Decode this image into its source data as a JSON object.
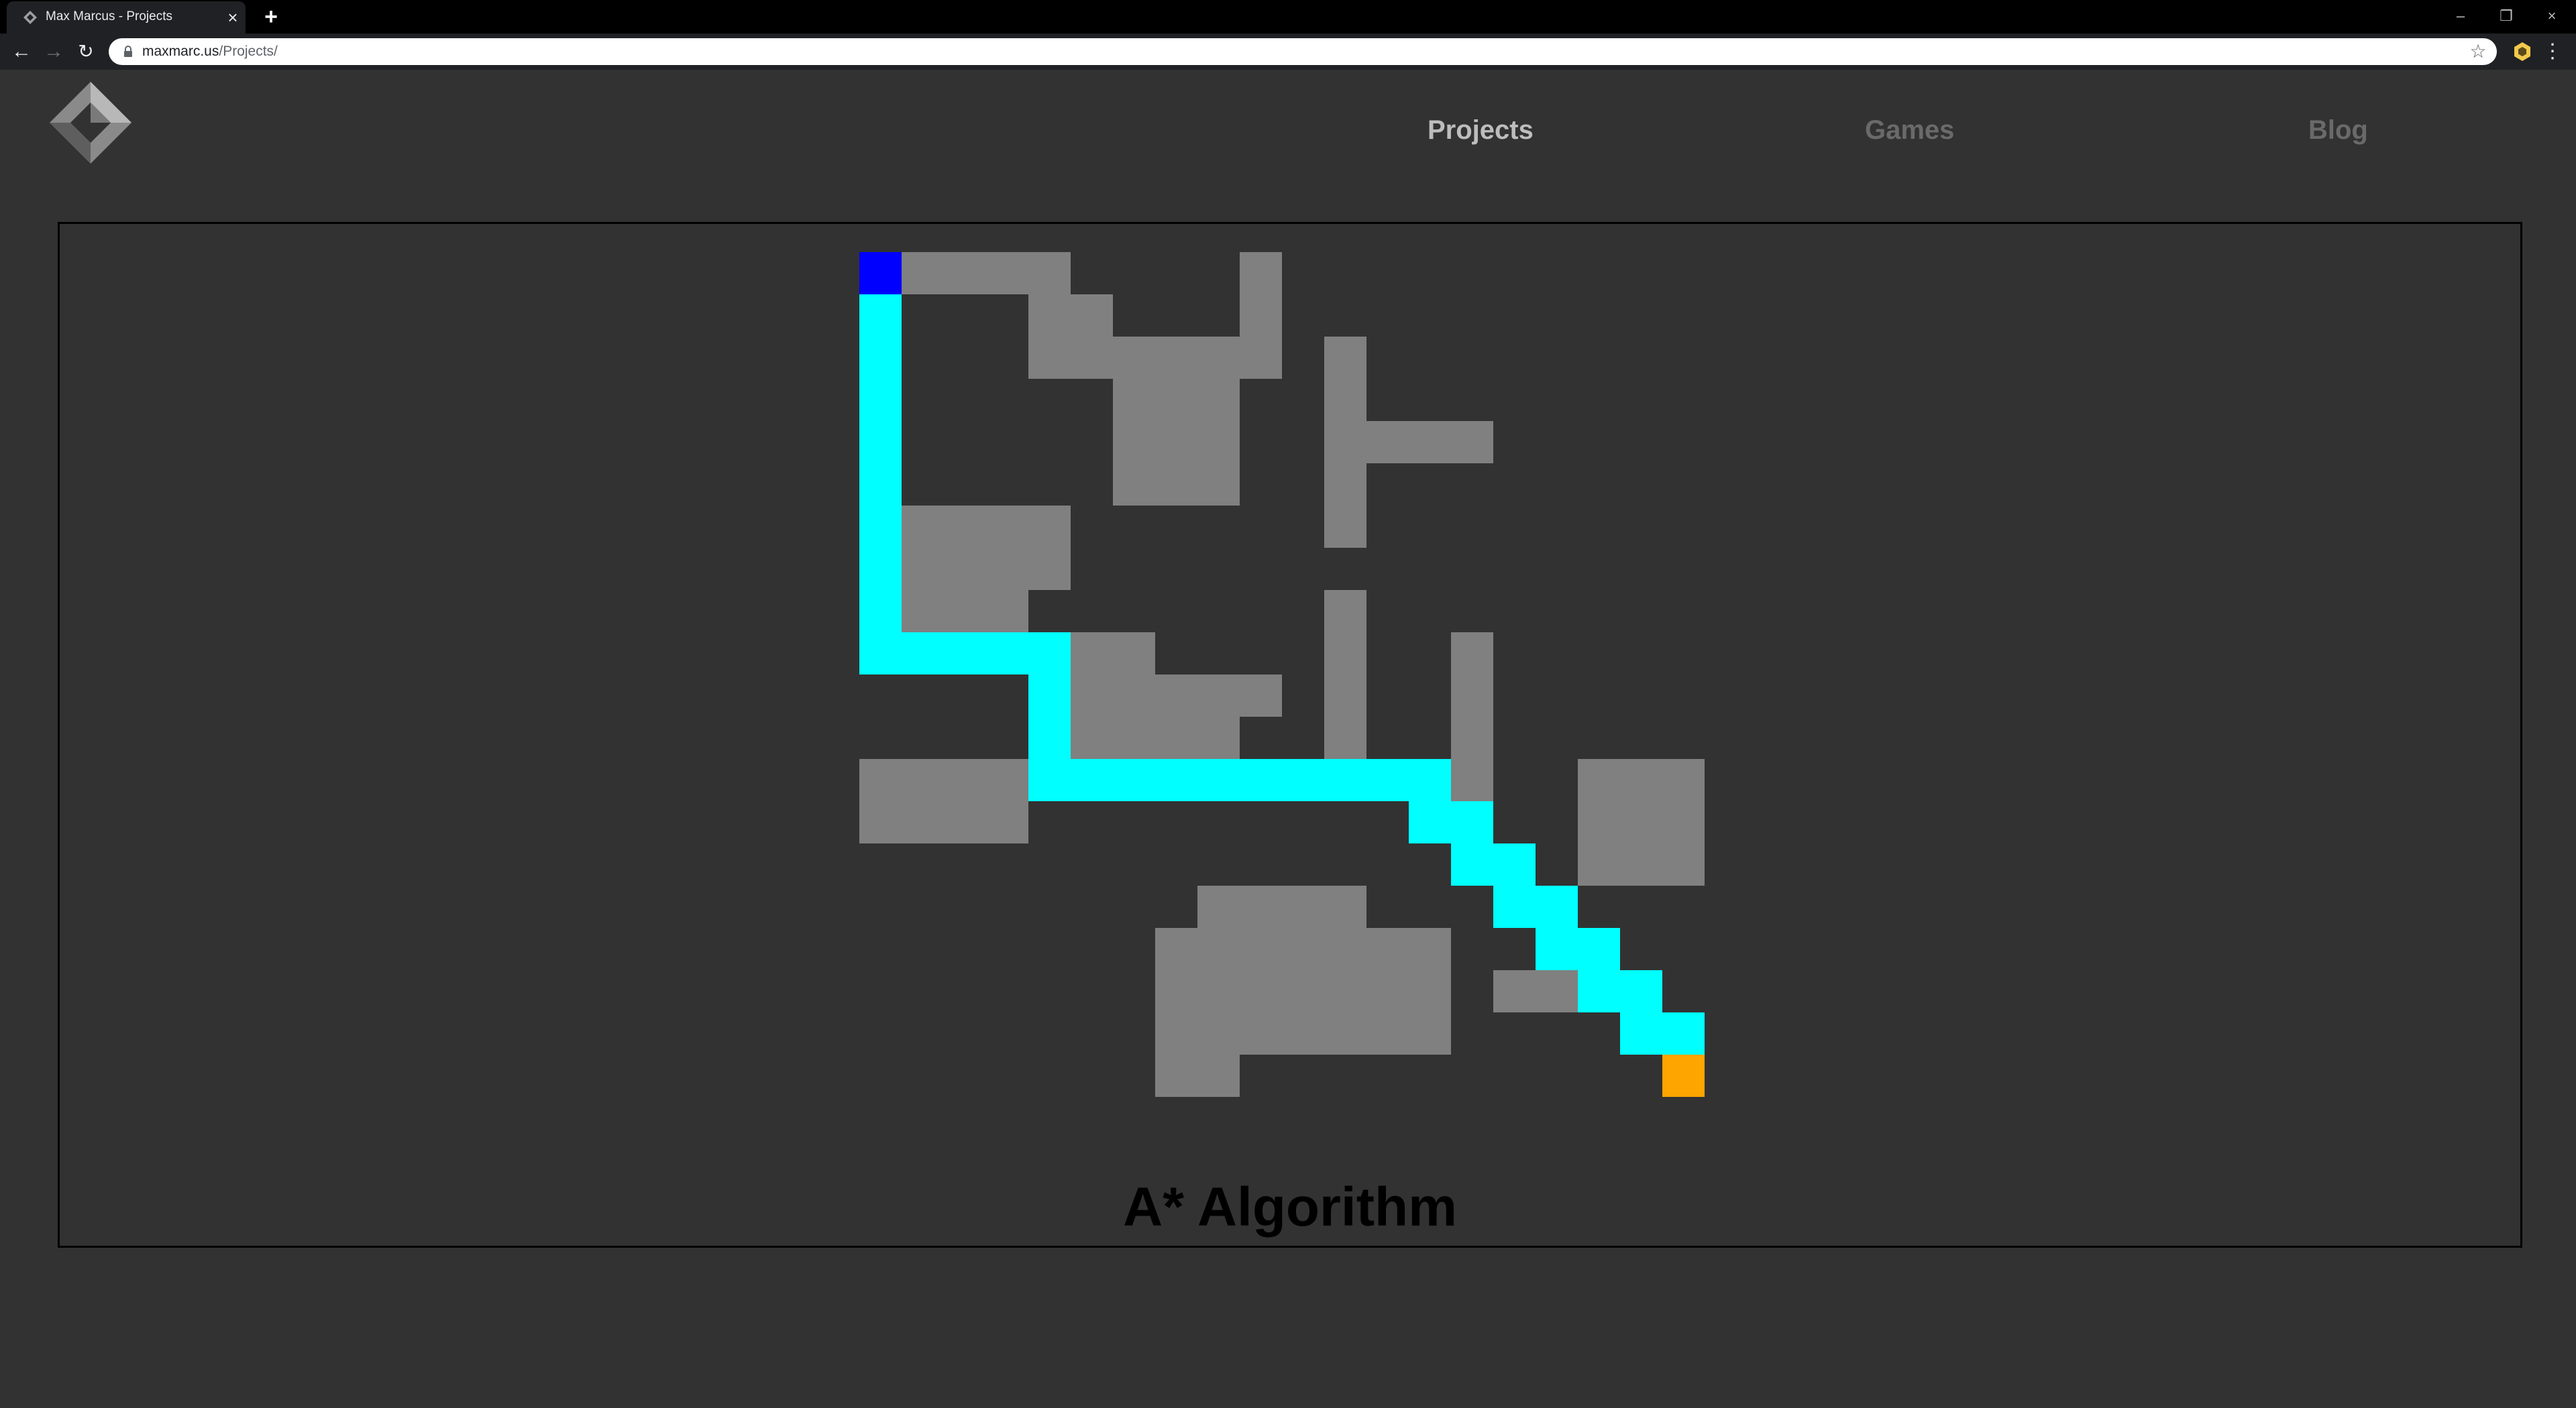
{
  "browser": {
    "tab_title": "Max Marcus - Projects",
    "url_host": "maxmarc.us",
    "url_path": "/Projects/"
  },
  "nav": {
    "links": [
      "Projects",
      "Games",
      "Blog"
    ],
    "active": "Projects"
  },
  "project": {
    "title": "A* Algorithm",
    "grid": {
      "rows": 20,
      "cols": 20,
      "colors": {
        "wall": "#808080",
        "path": "#00ffff",
        "start": "#0000ff",
        "goal": "#ffa500"
      },
      "start": [
        0,
        0
      ],
      "goal": [
        19,
        19
      ],
      "walls": [
        [
          0,
          1
        ],
        [
          0,
          2
        ],
        [
          0,
          3
        ],
        [
          0,
          4
        ],
        [
          0,
          9
        ],
        [
          1,
          4
        ],
        [
          1,
          5
        ],
        [
          1,
          9
        ],
        [
          2,
          4
        ],
        [
          2,
          5
        ],
        [
          2,
          6
        ],
        [
          2,
          7
        ],
        [
          2,
          8
        ],
        [
          2,
          9
        ],
        [
          2,
          11
        ],
        [
          3,
          6
        ],
        [
          3,
          7
        ],
        [
          3,
          8
        ],
        [
          3,
          11
        ],
        [
          4,
          6
        ],
        [
          4,
          7
        ],
        [
          4,
          8
        ],
        [
          4,
          11
        ],
        [
          4,
          12
        ],
        [
          4,
          13
        ],
        [
          4,
          14
        ],
        [
          5,
          6
        ],
        [
          5,
          7
        ],
        [
          5,
          8
        ],
        [
          5,
          11
        ],
        [
          6,
          1
        ],
        [
          6,
          2
        ],
        [
          6,
          3
        ],
        [
          6,
          4
        ],
        [
          6,
          11
        ],
        [
          7,
          1
        ],
        [
          7,
          2
        ],
        [
          7,
          3
        ],
        [
          7,
          4
        ],
        [
          8,
          1
        ],
        [
          8,
          2
        ],
        [
          8,
          3
        ],
        [
          8,
          11
        ],
        [
          9,
          5
        ],
        [
          9,
          6
        ],
        [
          9,
          11
        ],
        [
          9,
          14
        ],
        [
          10,
          5
        ],
        [
          10,
          6
        ],
        [
          10,
          7
        ],
        [
          10,
          8
        ],
        [
          10,
          9
        ],
        [
          10,
          11
        ],
        [
          10,
          14
        ],
        [
          11,
          5
        ],
        [
          11,
          6
        ],
        [
          11,
          7
        ],
        [
          11,
          8
        ],
        [
          11,
          11
        ],
        [
          11,
          14
        ],
        [
          12,
          0
        ],
        [
          12,
          1
        ],
        [
          12,
          2
        ],
        [
          12,
          3
        ],
        [
          12,
          14
        ],
        [
          12,
          17
        ],
        [
          12,
          18
        ],
        [
          12,
          19
        ],
        [
          13,
          0
        ],
        [
          13,
          1
        ],
        [
          13,
          2
        ],
        [
          13,
          3
        ],
        [
          13,
          17
        ],
        [
          13,
          18
        ],
        [
          13,
          19
        ],
        [
          14,
          17
        ],
        [
          14,
          18
        ],
        [
          14,
          19
        ],
        [
          15,
          8
        ],
        [
          15,
          9
        ],
        [
          15,
          10
        ],
        [
          15,
          11
        ],
        [
          16,
          7
        ],
        [
          16,
          8
        ],
        [
          16,
          9
        ],
        [
          16,
          10
        ],
        [
          16,
          11
        ],
        [
          16,
          12
        ],
        [
          16,
          13
        ],
        [
          17,
          7
        ],
        [
          17,
          8
        ],
        [
          17,
          9
        ],
        [
          17,
          10
        ],
        [
          17,
          11
        ],
        [
          17,
          12
        ],
        [
          17,
          13
        ],
        [
          17,
          15
        ],
        [
          17,
          16
        ],
        [
          18,
          7
        ],
        [
          18,
          8
        ],
        [
          18,
          9
        ],
        [
          18,
          10
        ],
        [
          18,
          11
        ],
        [
          18,
          12
        ],
        [
          18,
          13
        ],
        [
          19,
          7
        ],
        [
          19,
          8
        ]
      ],
      "path": [
        [
          1,
          0
        ],
        [
          2,
          0
        ],
        [
          3,
          0
        ],
        [
          4,
          0
        ],
        [
          5,
          0
        ],
        [
          6,
          0
        ],
        [
          7,
          0
        ],
        [
          8,
          0
        ],
        [
          9,
          0
        ],
        [
          9,
          1
        ],
        [
          9,
          2
        ],
        [
          9,
          3
        ],
        [
          9,
          4
        ],
        [
          10,
          4
        ],
        [
          11,
          4
        ],
        [
          12,
          4
        ],
        [
          12,
          5
        ],
        [
          12,
          6
        ],
        [
          12,
          7
        ],
        [
          12,
          8
        ],
        [
          12,
          9
        ],
        [
          12,
          10
        ],
        [
          12,
          11
        ],
        [
          12,
          12
        ],
        [
          12,
          13
        ],
        [
          13,
          13
        ],
        [
          13,
          14
        ],
        [
          14,
          14
        ],
        [
          14,
          15
        ],
        [
          15,
          15
        ],
        [
          15,
          16
        ],
        [
          16,
          16
        ],
        [
          16,
          17
        ],
        [
          17,
          17
        ],
        [
          17,
          18
        ],
        [
          18,
          18
        ],
        [
          18,
          19
        ]
      ]
    }
  }
}
